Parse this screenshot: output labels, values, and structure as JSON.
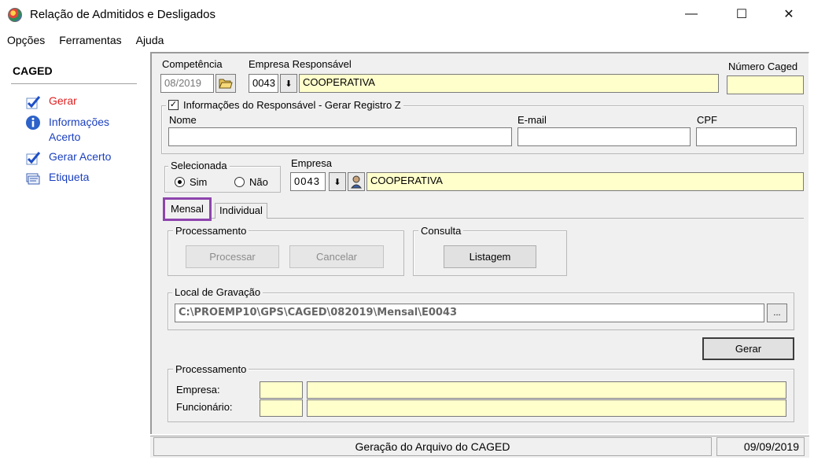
{
  "window": {
    "title": "Relação de Admitidos e Desligados",
    "minimize": "—",
    "maximize": "☐",
    "close": "✕"
  },
  "menu": {
    "items": [
      "Opções",
      "Ferramentas",
      "Ajuda"
    ]
  },
  "sidebar": {
    "title": "CAGED",
    "items": [
      {
        "label": "Gerar",
        "icon": "checkmark-icon"
      },
      {
        "label": "Informações Acerto",
        "icon": "info-icon"
      },
      {
        "label": "Gerar Acerto",
        "icon": "checkmark-icon"
      },
      {
        "label": "Etiqueta",
        "icon": "label-icon"
      }
    ]
  },
  "header": {
    "competencia_label": "Competência",
    "competencia_value": "08/2019",
    "empresa_resp_label": "Empresa Responsável",
    "empresa_resp_code": "0043",
    "empresa_resp_name": "COOPERATIVA",
    "numero_caged_label": "Número Caged",
    "numero_caged_value": ""
  },
  "responsavel": {
    "group_title": "Informações do Responsável - Gerar Registro Z",
    "checked": true,
    "check_mark": "✓",
    "nome_label": "Nome",
    "email_label": "E-mail",
    "cpf_label": "CPF",
    "nome_value": "",
    "email_value": "",
    "cpf_value": ""
  },
  "selecionada": {
    "title": "Selecionada",
    "sim_label": "Sim",
    "nao_label": "Não",
    "selected": "Sim"
  },
  "empresa": {
    "label": "Empresa",
    "code": "0043",
    "name": "COOPERATIVA"
  },
  "tabs": [
    {
      "label": "Mensal",
      "selected": true
    },
    {
      "label": "Individual",
      "selected": false
    }
  ],
  "processamento": {
    "title": "Processamento",
    "processar_label": "Processar",
    "cancelar_label": "Cancelar"
  },
  "consulta": {
    "title": "Consulta",
    "listagem_label": "Listagem"
  },
  "local_gravacao": {
    "title": "Local de Gravação",
    "path": "C:\\PROEMP10\\GPS\\CAGED\\082019\\Mensal\\E0043",
    "browse_label": "..."
  },
  "gerar_label": "Gerar",
  "processamento2": {
    "title": "Processamento",
    "empresa_label": "Empresa:",
    "funcionario_label": "Funcionário:"
  },
  "status": {
    "message": "Geração do Arquivo do CAGED",
    "date": "09/09/2019"
  },
  "colors": {
    "accent_red": "#e21d1d",
    "link_blue": "#1a3fbf",
    "highlight_purple": "#8e44ad",
    "field_yellow": "#ffffcc"
  }
}
